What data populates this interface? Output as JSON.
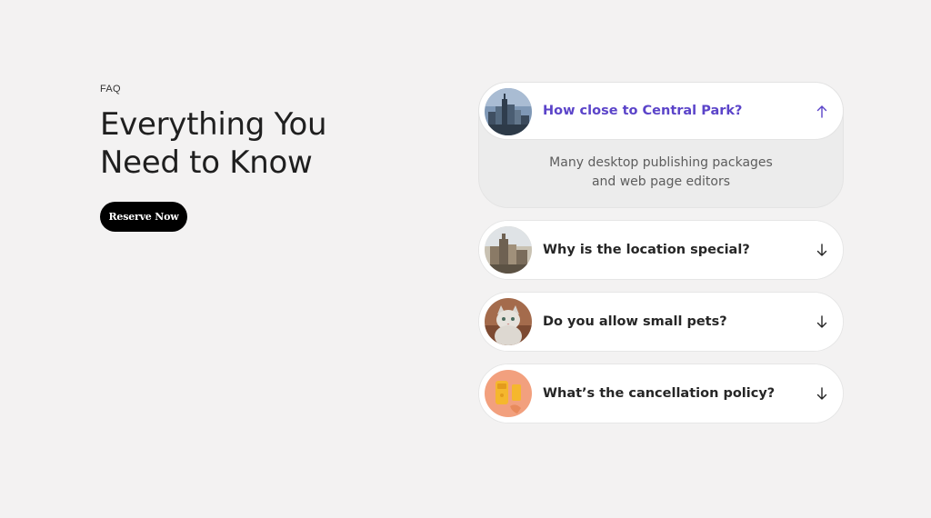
{
  "hero": {
    "eyebrow": "FAQ",
    "headline_line1": "Everything You",
    "headline_line2": "Need to Know",
    "cta_label": "Reserve Now"
  },
  "faq": {
    "items": [
      {
        "question": "How close to Central Park?",
        "expanded": true,
        "answer_line1": "Many desktop publishing packages",
        "answer_line2": "and web page editors",
        "image": "city-skyline-thumbnail",
        "arrow_icon": "arrow-up-icon"
      },
      {
        "question": "Why is the location special?",
        "expanded": false,
        "image": "building-thumbnail",
        "arrow_icon": "arrow-down-icon"
      },
      {
        "question": "Do you allow small pets?",
        "expanded": false,
        "image": "cat-thumbnail",
        "arrow_icon": "arrow-down-icon"
      },
      {
        "question": "What’s the cancellation policy?",
        "expanded": false,
        "image": "phone-thumbnail",
        "arrow_icon": "arrow-down-icon"
      }
    ]
  },
  "colors": {
    "background": "#f3f2f2",
    "accent": "#5b44c9",
    "cta_background": "#000000"
  }
}
